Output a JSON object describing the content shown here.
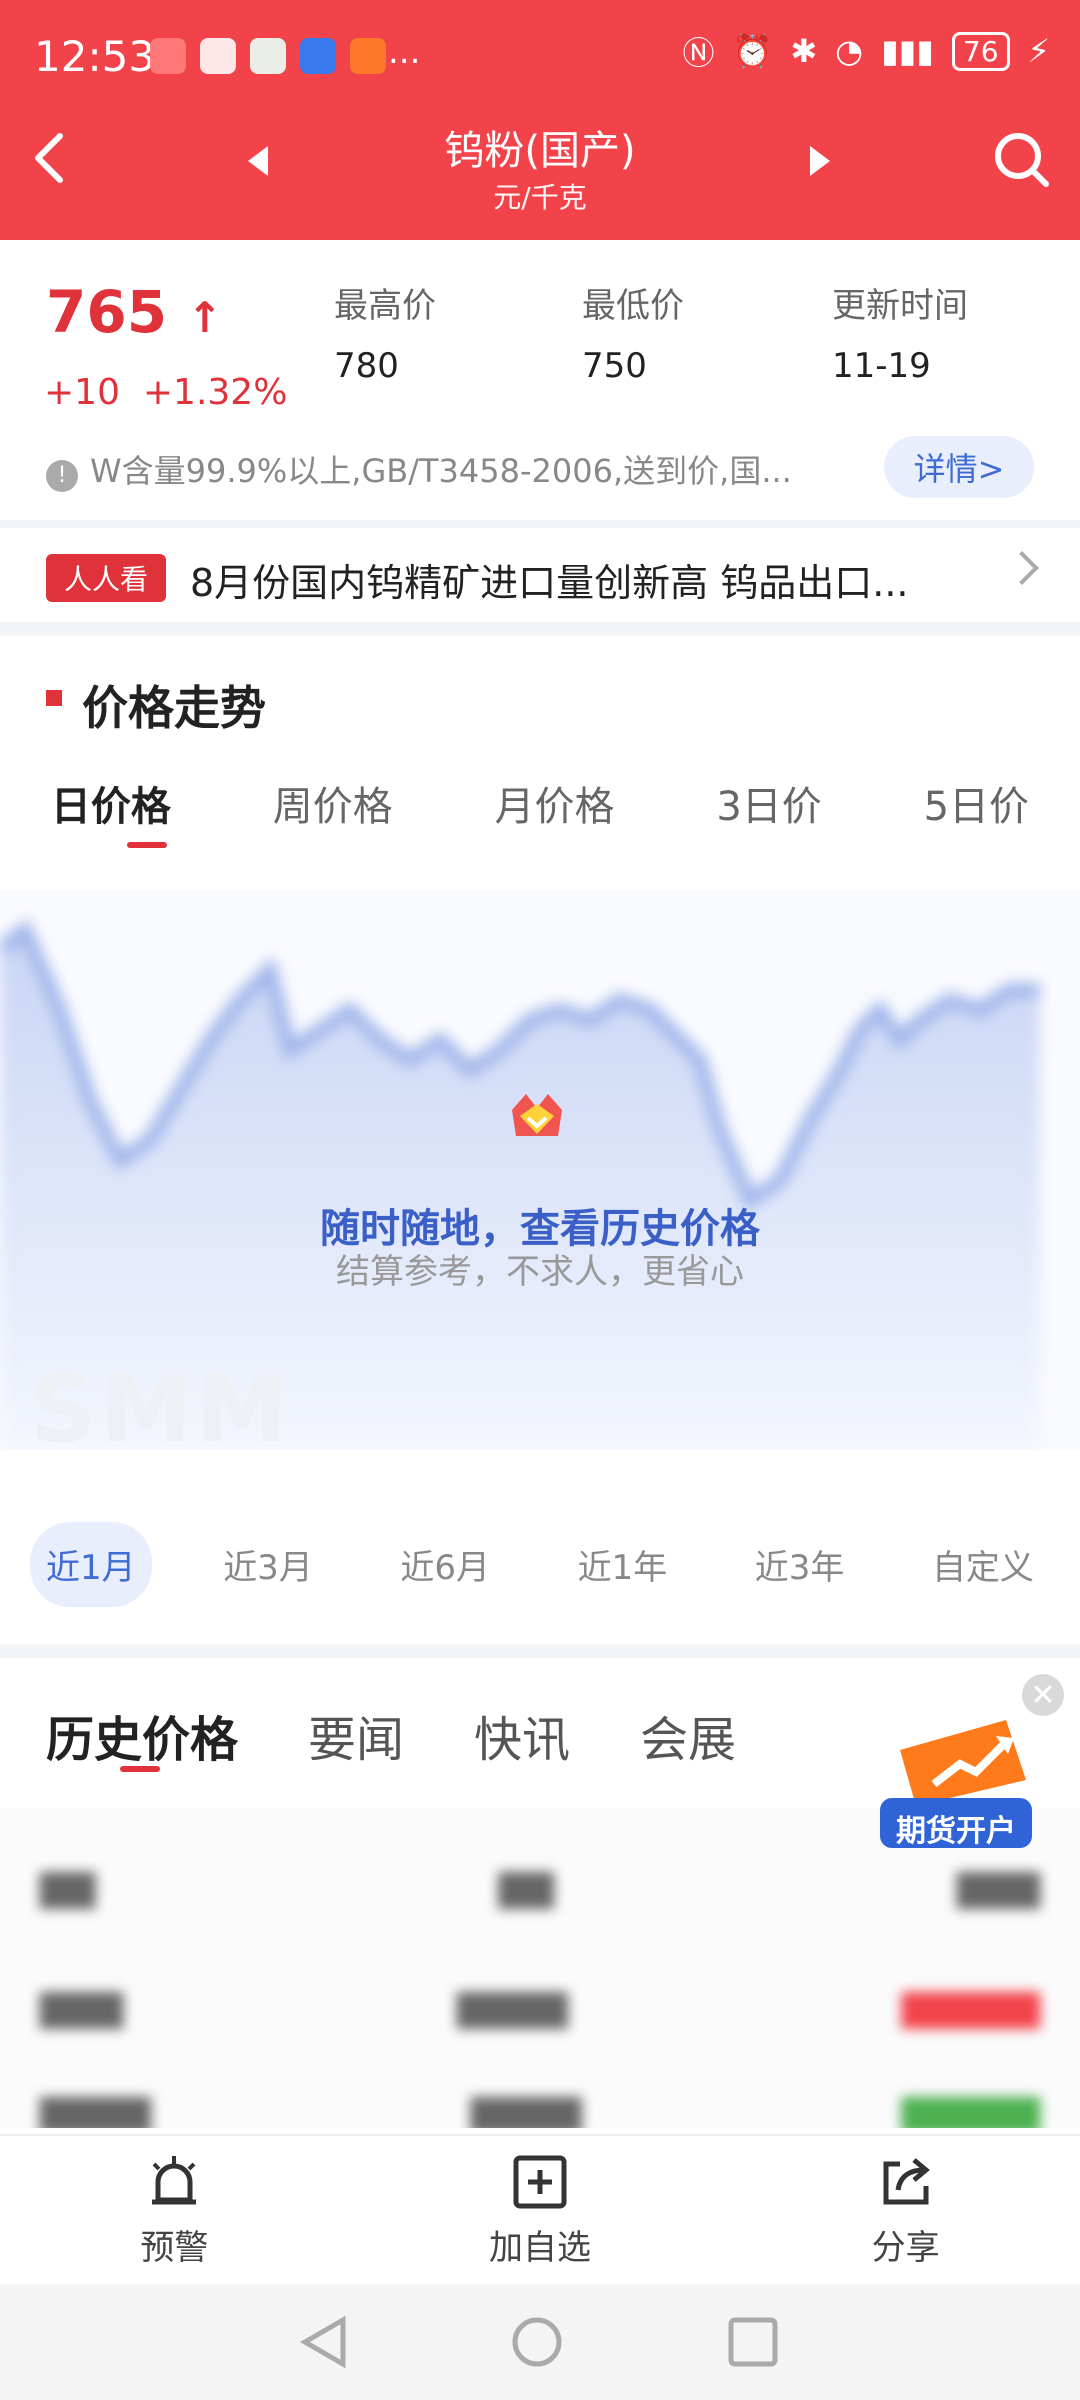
{
  "status_bar": {
    "time": "12:53",
    "battery": "76",
    "overflow": "..."
  },
  "header": {
    "title": "钨粉(国产)",
    "unit": "元/千克"
  },
  "summary": {
    "price": "765",
    "change_abs": "+10",
    "change_pct": "+1.32%",
    "high_label": "最高价",
    "high_value": "780",
    "low_label": "最低价",
    "low_value": "750",
    "time_label": "更新时间",
    "time_value": "11-19",
    "desc": "W含量99.9%以上,GB/T3458-2006,送到价,国...",
    "detail": "详情>"
  },
  "news": {
    "tag": "人人看",
    "text": "8月份国内钨精矿进口量创新高 钨品出口..."
  },
  "trend": {
    "title": "价格走势",
    "tabs": [
      "日价格",
      "周价格",
      "月价格",
      "3日价",
      "5日价"
    ],
    "overlay_title": "随时随地，查看历史价格",
    "overlay_sub": "结算参考，不求人，更省心",
    "watermark": "SMM"
  },
  "ranges": [
    "近1月",
    "近3月",
    "近6月",
    "近1年",
    "近3年",
    "自定义"
  ],
  "bottom_tabs": [
    "历史价格",
    "要闻",
    "快讯",
    "会展"
  ],
  "ad": {
    "label": "期货开户"
  },
  "footer": {
    "alert": "预警",
    "add": "加自选",
    "share": "分享"
  },
  "colors": {
    "header_red": "#f2434a",
    "accent_blue": "#3f6bd3",
    "price_red": "#e0323b"
  }
}
